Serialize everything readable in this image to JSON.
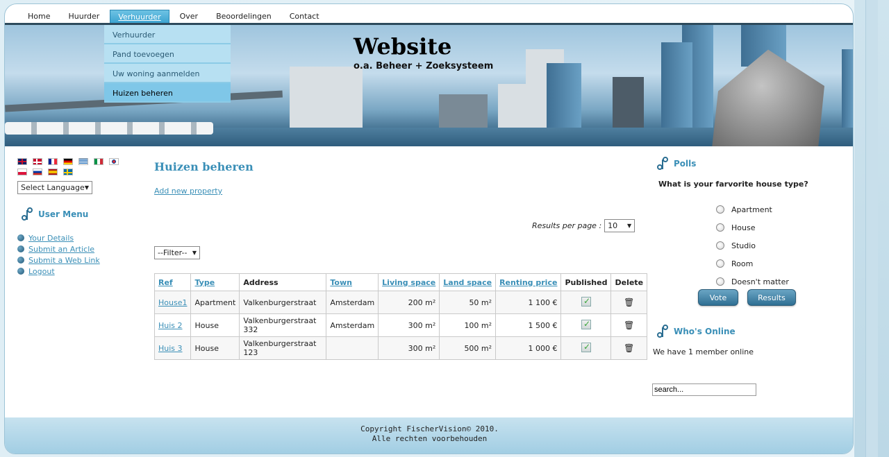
{
  "nav": {
    "items": [
      {
        "label": "Home"
      },
      {
        "label": "Huurder"
      },
      {
        "label": "Verhuurder"
      },
      {
        "label": "Over"
      },
      {
        "label": "Beoordelingen"
      },
      {
        "label": "Contact"
      }
    ],
    "active": "Verhuurder"
  },
  "dropdown": {
    "items": [
      {
        "label": "Verhuurder"
      },
      {
        "label": "Pand toevoegen"
      },
      {
        "label": "Uw woning aanmelden"
      },
      {
        "label": "Huizen beheren"
      }
    ],
    "active": "Huizen beheren"
  },
  "banner": {
    "title": "Website",
    "subtitle": "o.a. Beheer + Zoeksysteem"
  },
  "language": {
    "flags": [
      "english-flag",
      "danish-flag",
      "french-flag",
      "german-flag",
      "greek-flag",
      "italian-flag",
      "korean-flag",
      "polish-flag",
      "russian-flag",
      "spanish-flag",
      "swedish-flag"
    ],
    "select_label": "Select Language"
  },
  "user_menu": {
    "title": "User Menu",
    "items": [
      {
        "label": "Your Details"
      },
      {
        "label": "Submit an Article"
      },
      {
        "label": "Submit a Web Link"
      },
      {
        "label": "Logout"
      }
    ]
  },
  "main": {
    "title": "Huizen beheren",
    "add_link": "Add new property",
    "results_per_page_label": "Results per page :",
    "results_per_page_value": "10",
    "filter_label": "--Filter--",
    "columns": [
      "Ref",
      "Type",
      "Address",
      "Town",
      "Living space",
      "Land space",
      "Renting price",
      "Published",
      "Delete"
    ],
    "rows": [
      {
        "ref": "House1",
        "type": "Apartment",
        "address": "Valkenburgerstraat",
        "town": "Amsterdam",
        "living": "200 m²",
        "land": "50 m²",
        "price": "1 100 €"
      },
      {
        "ref": "Huis 2",
        "type": "House",
        "address": "Valkenburgerstraat 332",
        "town": "Amsterdam",
        "living": "300 m²",
        "land": "100 m²",
        "price": "1 500 €"
      },
      {
        "ref": "Huis 3",
        "type": "House",
        "address": "Valkenburgerstraat 123",
        "town": "",
        "living": "300 m²",
        "land": "500 m²",
        "price": "1 000 €"
      }
    ]
  },
  "polls": {
    "title": "Polls",
    "question": "What is your farvorite house type?",
    "options": [
      {
        "label": "Apartment"
      },
      {
        "label": "House"
      },
      {
        "label": "Studio"
      },
      {
        "label": "Room"
      },
      {
        "label": "Doesn't matter"
      }
    ],
    "vote_label": "Vote",
    "results_label": "Results"
  },
  "whos_online": {
    "title": "Who's Online",
    "text": "We have 1 member online"
  },
  "search": {
    "value": "search..."
  },
  "footer": {
    "line1": "Copyright FischerVision© 2010.",
    "line2": "Alle rechten voorbehouden"
  },
  "colors": {
    "accent": "#3a8fb7",
    "nav_active": "#3aa2cf",
    "dropdown_bg": "#b7e0f2",
    "dropdown_active": "#7fc7e8"
  }
}
